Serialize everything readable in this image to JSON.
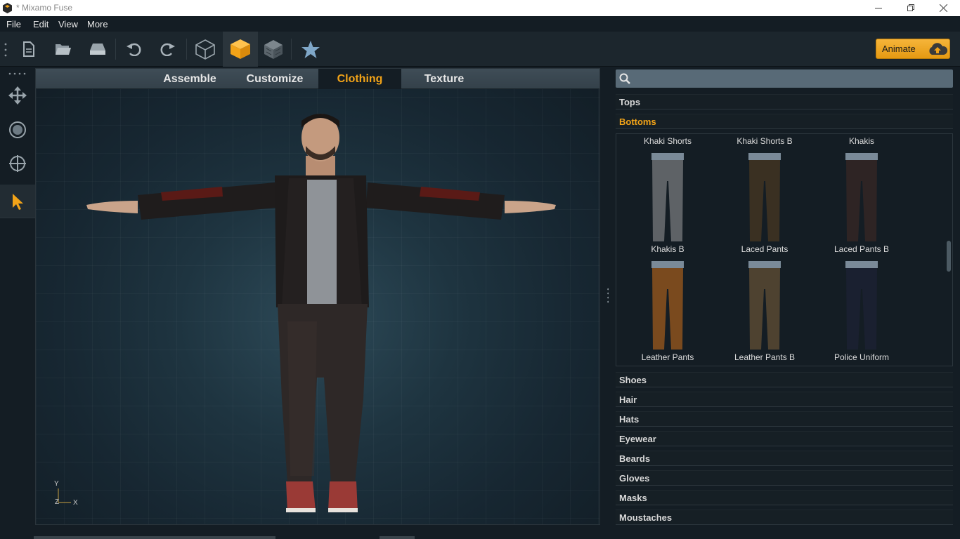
{
  "window": {
    "title": "* Mixamo Fuse"
  },
  "menu": {
    "items": [
      "File",
      "Edit",
      "View",
      "More"
    ]
  },
  "toolbar": {
    "animate_label": "Animate"
  },
  "tabs": [
    "Assemble",
    "Customize",
    "Clothing",
    "Texture"
  ],
  "active_tab": "Clothing",
  "axis": {
    "y": "Y",
    "z": "Z",
    "x": "X"
  },
  "search": {
    "placeholder": ""
  },
  "categories_top": [
    "Tops",
    "Bottoms"
  ],
  "open_category": "Bottoms",
  "clothing_items": [
    {
      "label_top": "Khaki Shorts",
      "color": "#6c6f72"
    },
    {
      "label_top": "Khaki Shorts B",
      "color": "#3f3528"
    },
    {
      "label_top": "Khakis",
      "color": "#3a2c28"
    },
    {
      "label_bottom": "Khakis B",
      "label_top": "Khakis B",
      "color": "#8a5a2a"
    },
    {
      "label_bottom": "Laced Pants",
      "color": "#5a4c36"
    },
    {
      "label_bottom": "Laced Pants B",
      "color": "#1c2230"
    }
  ],
  "grid_labels": {
    "row1": [
      "Khaki Shorts",
      "Khaki Shorts B",
      "Khakis"
    ],
    "row2": [
      "Khakis B",
      "Laced Pants",
      "Laced Pants B"
    ],
    "row3": [
      "Leather Pants",
      "Leather Pants B",
      "Police Uniform"
    ]
  },
  "categories_bottom": [
    "Shoes",
    "Hair",
    "Hats",
    "Eyewear",
    "Beards",
    "Gloves",
    "Masks",
    "Moustaches"
  ],
  "colors": {
    "accent": "#f2a318",
    "background": "#141d24",
    "tab_bar": "#3a4852"
  }
}
